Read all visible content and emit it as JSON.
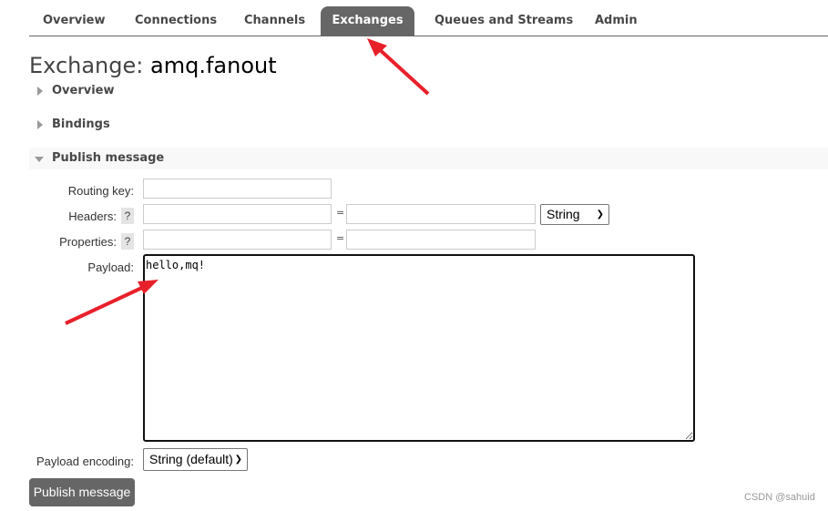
{
  "nav": {
    "tabs": [
      {
        "label": "Overview",
        "active": false
      },
      {
        "label": "Connections",
        "active": false
      },
      {
        "label": "Channels",
        "active": false
      },
      {
        "label": "Exchanges",
        "active": true
      },
      {
        "label": "Queues and Streams",
        "active": false
      },
      {
        "label": "Admin",
        "active": false
      }
    ]
  },
  "page": {
    "title_prefix": "Exchange:",
    "title_name": "amq.fanout"
  },
  "sections": {
    "overview": "Overview",
    "bindings": "Bindings",
    "publish": "Publish message"
  },
  "form": {
    "routing_key_label": "Routing key:",
    "routing_key_value": "",
    "headers_label": "Headers:",
    "properties_label": "Properties:",
    "help": "?",
    "equals": "=",
    "header_type": "String",
    "payload_label": "Payload:",
    "payload_value": "hello,mq!",
    "encoding_label": "Payload encoding:",
    "encoding_value": "String (default)",
    "publish_button": "Publish message"
  },
  "watermark": "CSDN @sahuid",
  "annotation_color": "#e8202a"
}
